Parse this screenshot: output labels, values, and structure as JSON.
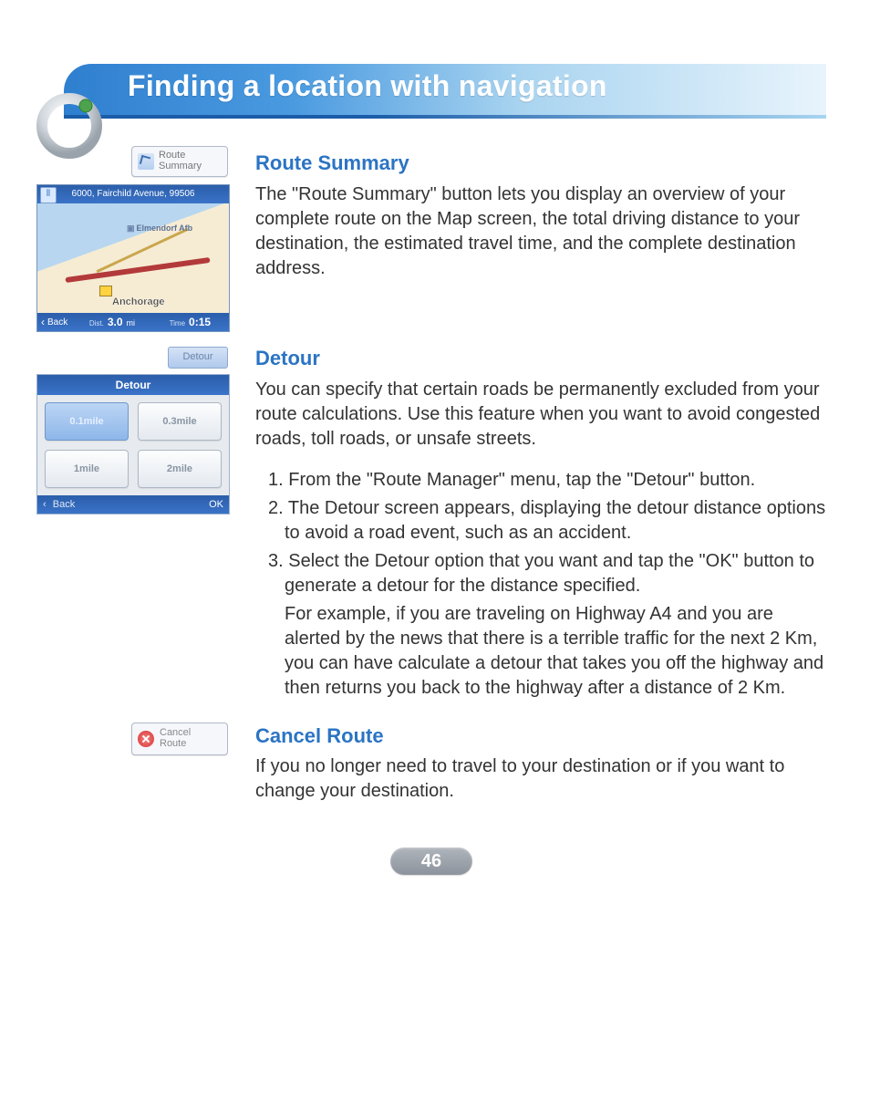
{
  "header": {
    "title": "Finding a location with navigation"
  },
  "routeSummary": {
    "buttonLabel": "Route\nSummary",
    "heading": "Route Summary",
    "body": "The \"Route Summary\" button lets you display an overview of your complete route on the Map screen, the total driving distance to your destination, the estimated travel time, and the complete destination address.",
    "screenshot": {
      "address": "6000, Fairchild Avenue, 99506",
      "label_elmendorf": "Elmendorf Afb",
      "label_anchorage": "Anchorage",
      "backLabel": "Back",
      "distLabel": "Dist.",
      "distValue": "3.0",
      "distUnit": "mi",
      "timeLabel": "Time",
      "timeValue": "0:15"
    }
  },
  "detour": {
    "buttonLabel": "Detour",
    "heading": "Detour",
    "intro": "You can specify that certain roads be permanently excluded from your route calculations. Use this feature when you want to avoid congested roads, toll roads, or unsafe streets.",
    "step1": "1. From the \"Route Manager\" menu, tap the \"Detour\" button.",
    "step2": "2. The Detour screen appears, displaying the detour distance options to avoid a road event, such as an accident.",
    "step3a": "3. Select the Detour option that you want and tap the \"OK\" button to generate a detour for the distance specified.",
    "step3b": "For example, if you are traveling on Highway A4 and you are alerted by the news that there is a terrible traffic for the next 2 Km, you can have calculate a detour that takes you off the highway and then returns you back to the highway after a distance of 2 Km.",
    "screenshot": {
      "title": "Detour",
      "options": [
        "0.1mile",
        "0.3mile",
        "1mile",
        "2mile"
      ],
      "selectedIndex": 0,
      "backLabel": "Back",
      "okLabel": "OK"
    }
  },
  "cancelRoute": {
    "buttonLabel": "Cancel\nRoute",
    "heading": "Cancel Route",
    "body": "If you no longer need to travel to your destination or if you want to change your destination."
  },
  "pageNumber": "46"
}
